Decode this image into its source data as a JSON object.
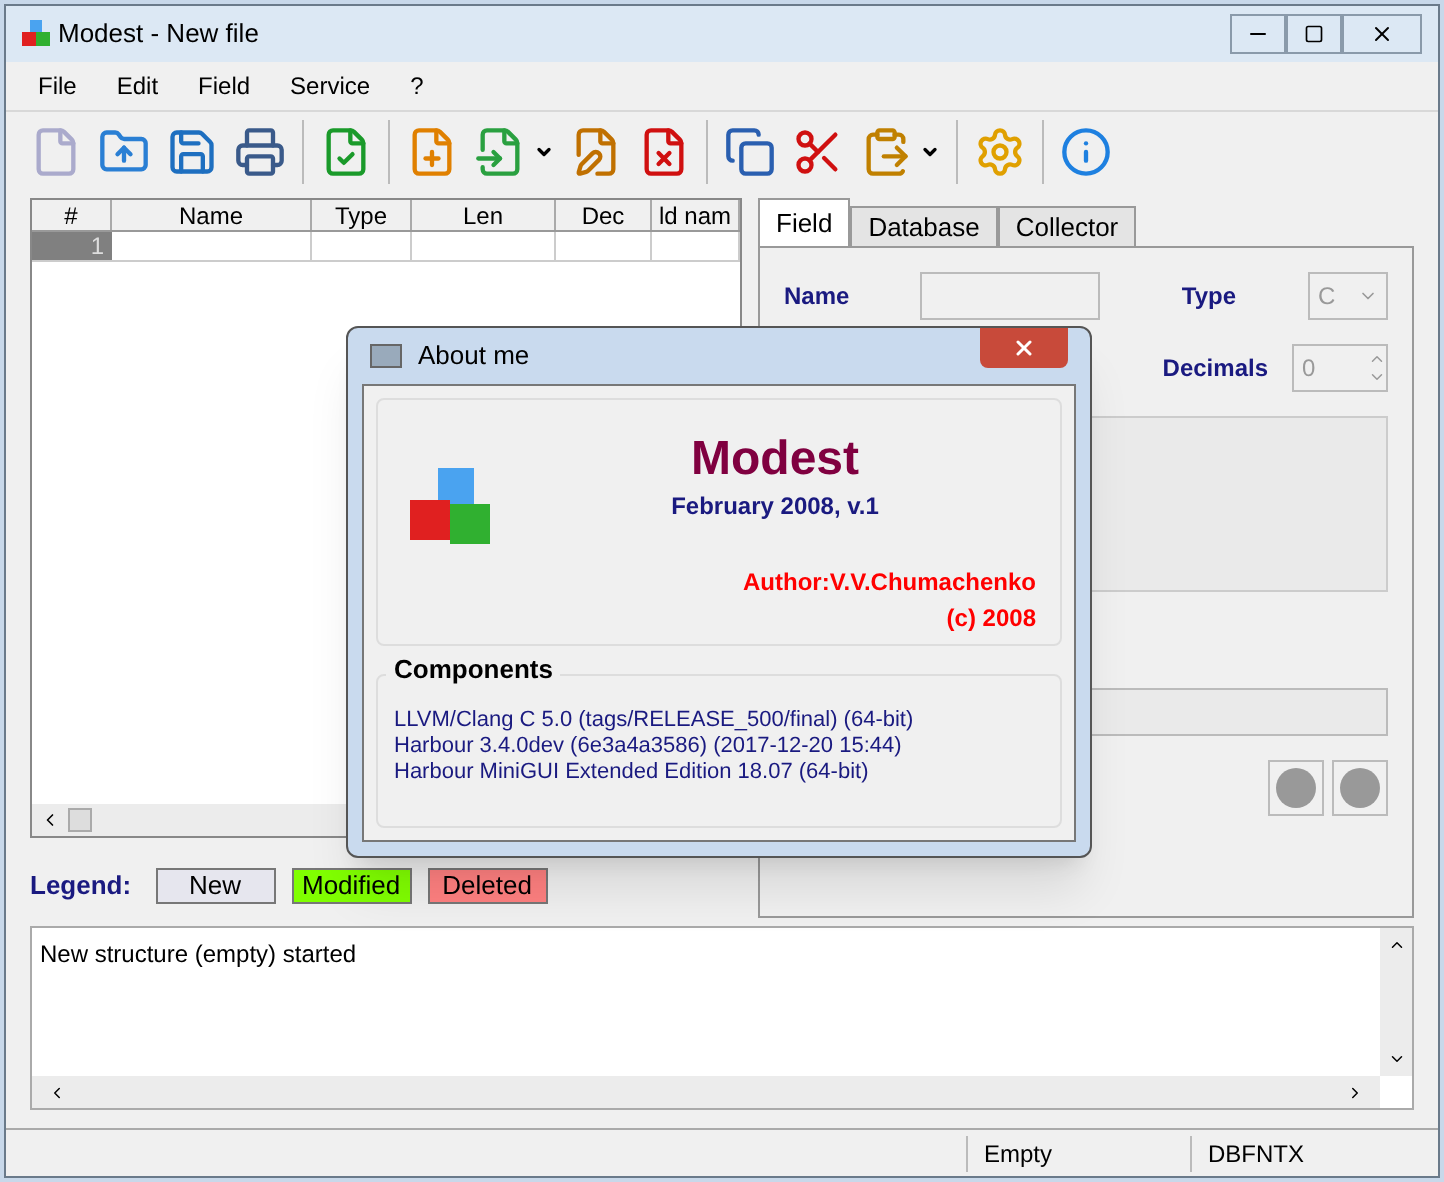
{
  "window": {
    "title": "Modest - New file"
  },
  "menu": [
    "File",
    "Edit",
    "Field",
    "Service",
    "?"
  ],
  "grid": {
    "columns": [
      "#",
      "Name",
      "Type",
      "Len",
      "Dec",
      "ld nam"
    ],
    "rows": [
      {
        "number": "1"
      }
    ]
  },
  "tabs": [
    {
      "label": "Field",
      "selected": true
    },
    {
      "label": "Database",
      "selected": false
    },
    {
      "label": "Collector",
      "selected": false
    }
  ],
  "field_form": {
    "name_label": "Name",
    "type_label": "Type",
    "type_value": "C",
    "decimals_label": "Decimals",
    "decimals_value": "0"
  },
  "legend": {
    "label": "Legend:",
    "items": [
      {
        "label": "New",
        "color": "#e6e6ee"
      },
      {
        "label": "Modified",
        "color": "#80ff00"
      },
      {
        "label": "Deleted",
        "color": "#ff8080"
      }
    ]
  },
  "log": [
    "New structure (empty) started"
  ],
  "status_bar": [
    "Empty",
    "DBFNTX"
  ],
  "dialog": {
    "title": "About me",
    "app_name": "Modest",
    "version": "February 2008, v.1",
    "author": "Author:V.V.Chumachenko",
    "copyright": "(c) 2008",
    "components_heading": "Components",
    "components": [
      "LLVM/Clang C 5.0 (tags/RELEASE_500/final) (64-bit)",
      "Harbour 3.4.0dev (6e3a4a3586) (2017-12-20 15:44)",
      "Harbour MiniGUI Extended Edition 18.07 (64-bit)"
    ]
  }
}
